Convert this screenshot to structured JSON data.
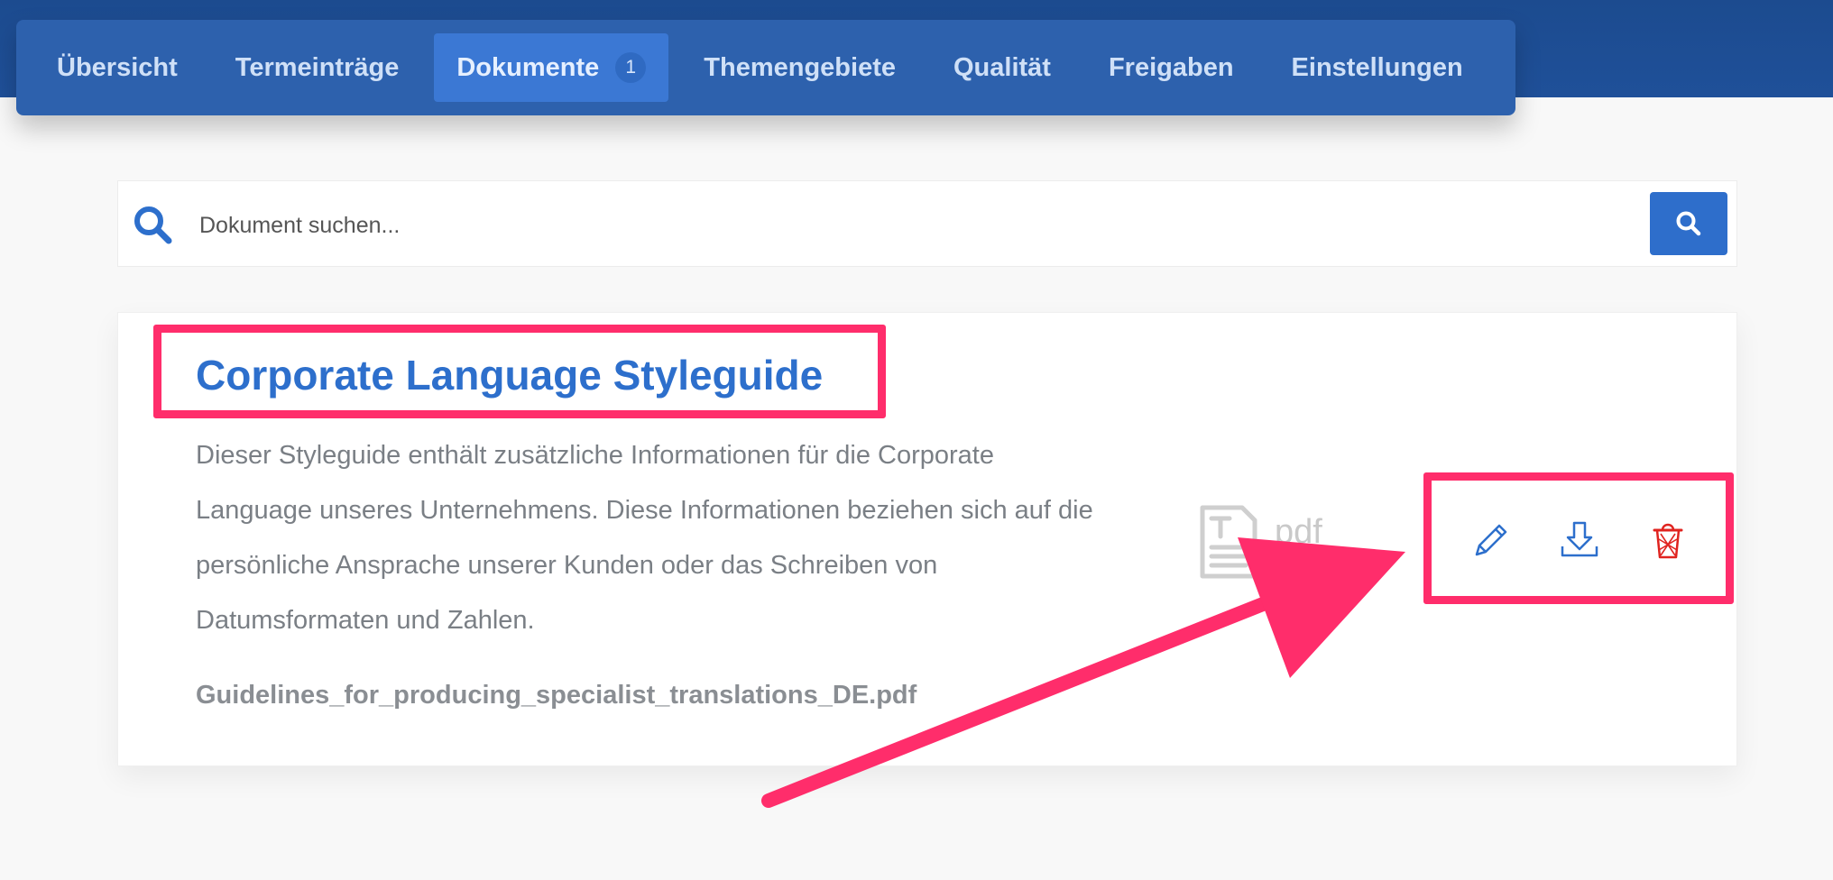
{
  "nav": {
    "items": [
      {
        "label": "Übersicht"
      },
      {
        "label": "Termeinträge"
      },
      {
        "label": "Dokumente",
        "badge": "1",
        "active": true
      },
      {
        "label": "Themengebiete"
      },
      {
        "label": "Qualität"
      },
      {
        "label": "Freigaben"
      },
      {
        "label": "Einstellungen"
      }
    ]
  },
  "search": {
    "placeholder": "Dokument suchen...",
    "value": ""
  },
  "document": {
    "title": "Corporate Language Styleguide",
    "description": "Dieser Styleguide enthält zusätzliche Informationen für die Corporate Language unseres Unternehmens. Diese Informationen beziehen sich auf die persönliche Ansprache unserer Kunden oder das Schreiben von Datumsformaten und Zahlen.",
    "filename": "Guidelines_for_producing_specialist_translations_DE.pdf",
    "filetype": "pdf",
    "actions": [
      {
        "name": "edit",
        "icon": "pencil-icon",
        "color": "#2d6fcc"
      },
      {
        "name": "download",
        "icon": "download-icon",
        "color": "#2d6fcc"
      },
      {
        "name": "delete",
        "icon": "trash-icon",
        "color": "#e0231f"
      }
    ]
  },
  "colors": {
    "accent": "#2d6fcc",
    "highlight": "#ff2d6b",
    "nav_bg": "#2d61ad",
    "danger": "#e0231f"
  }
}
